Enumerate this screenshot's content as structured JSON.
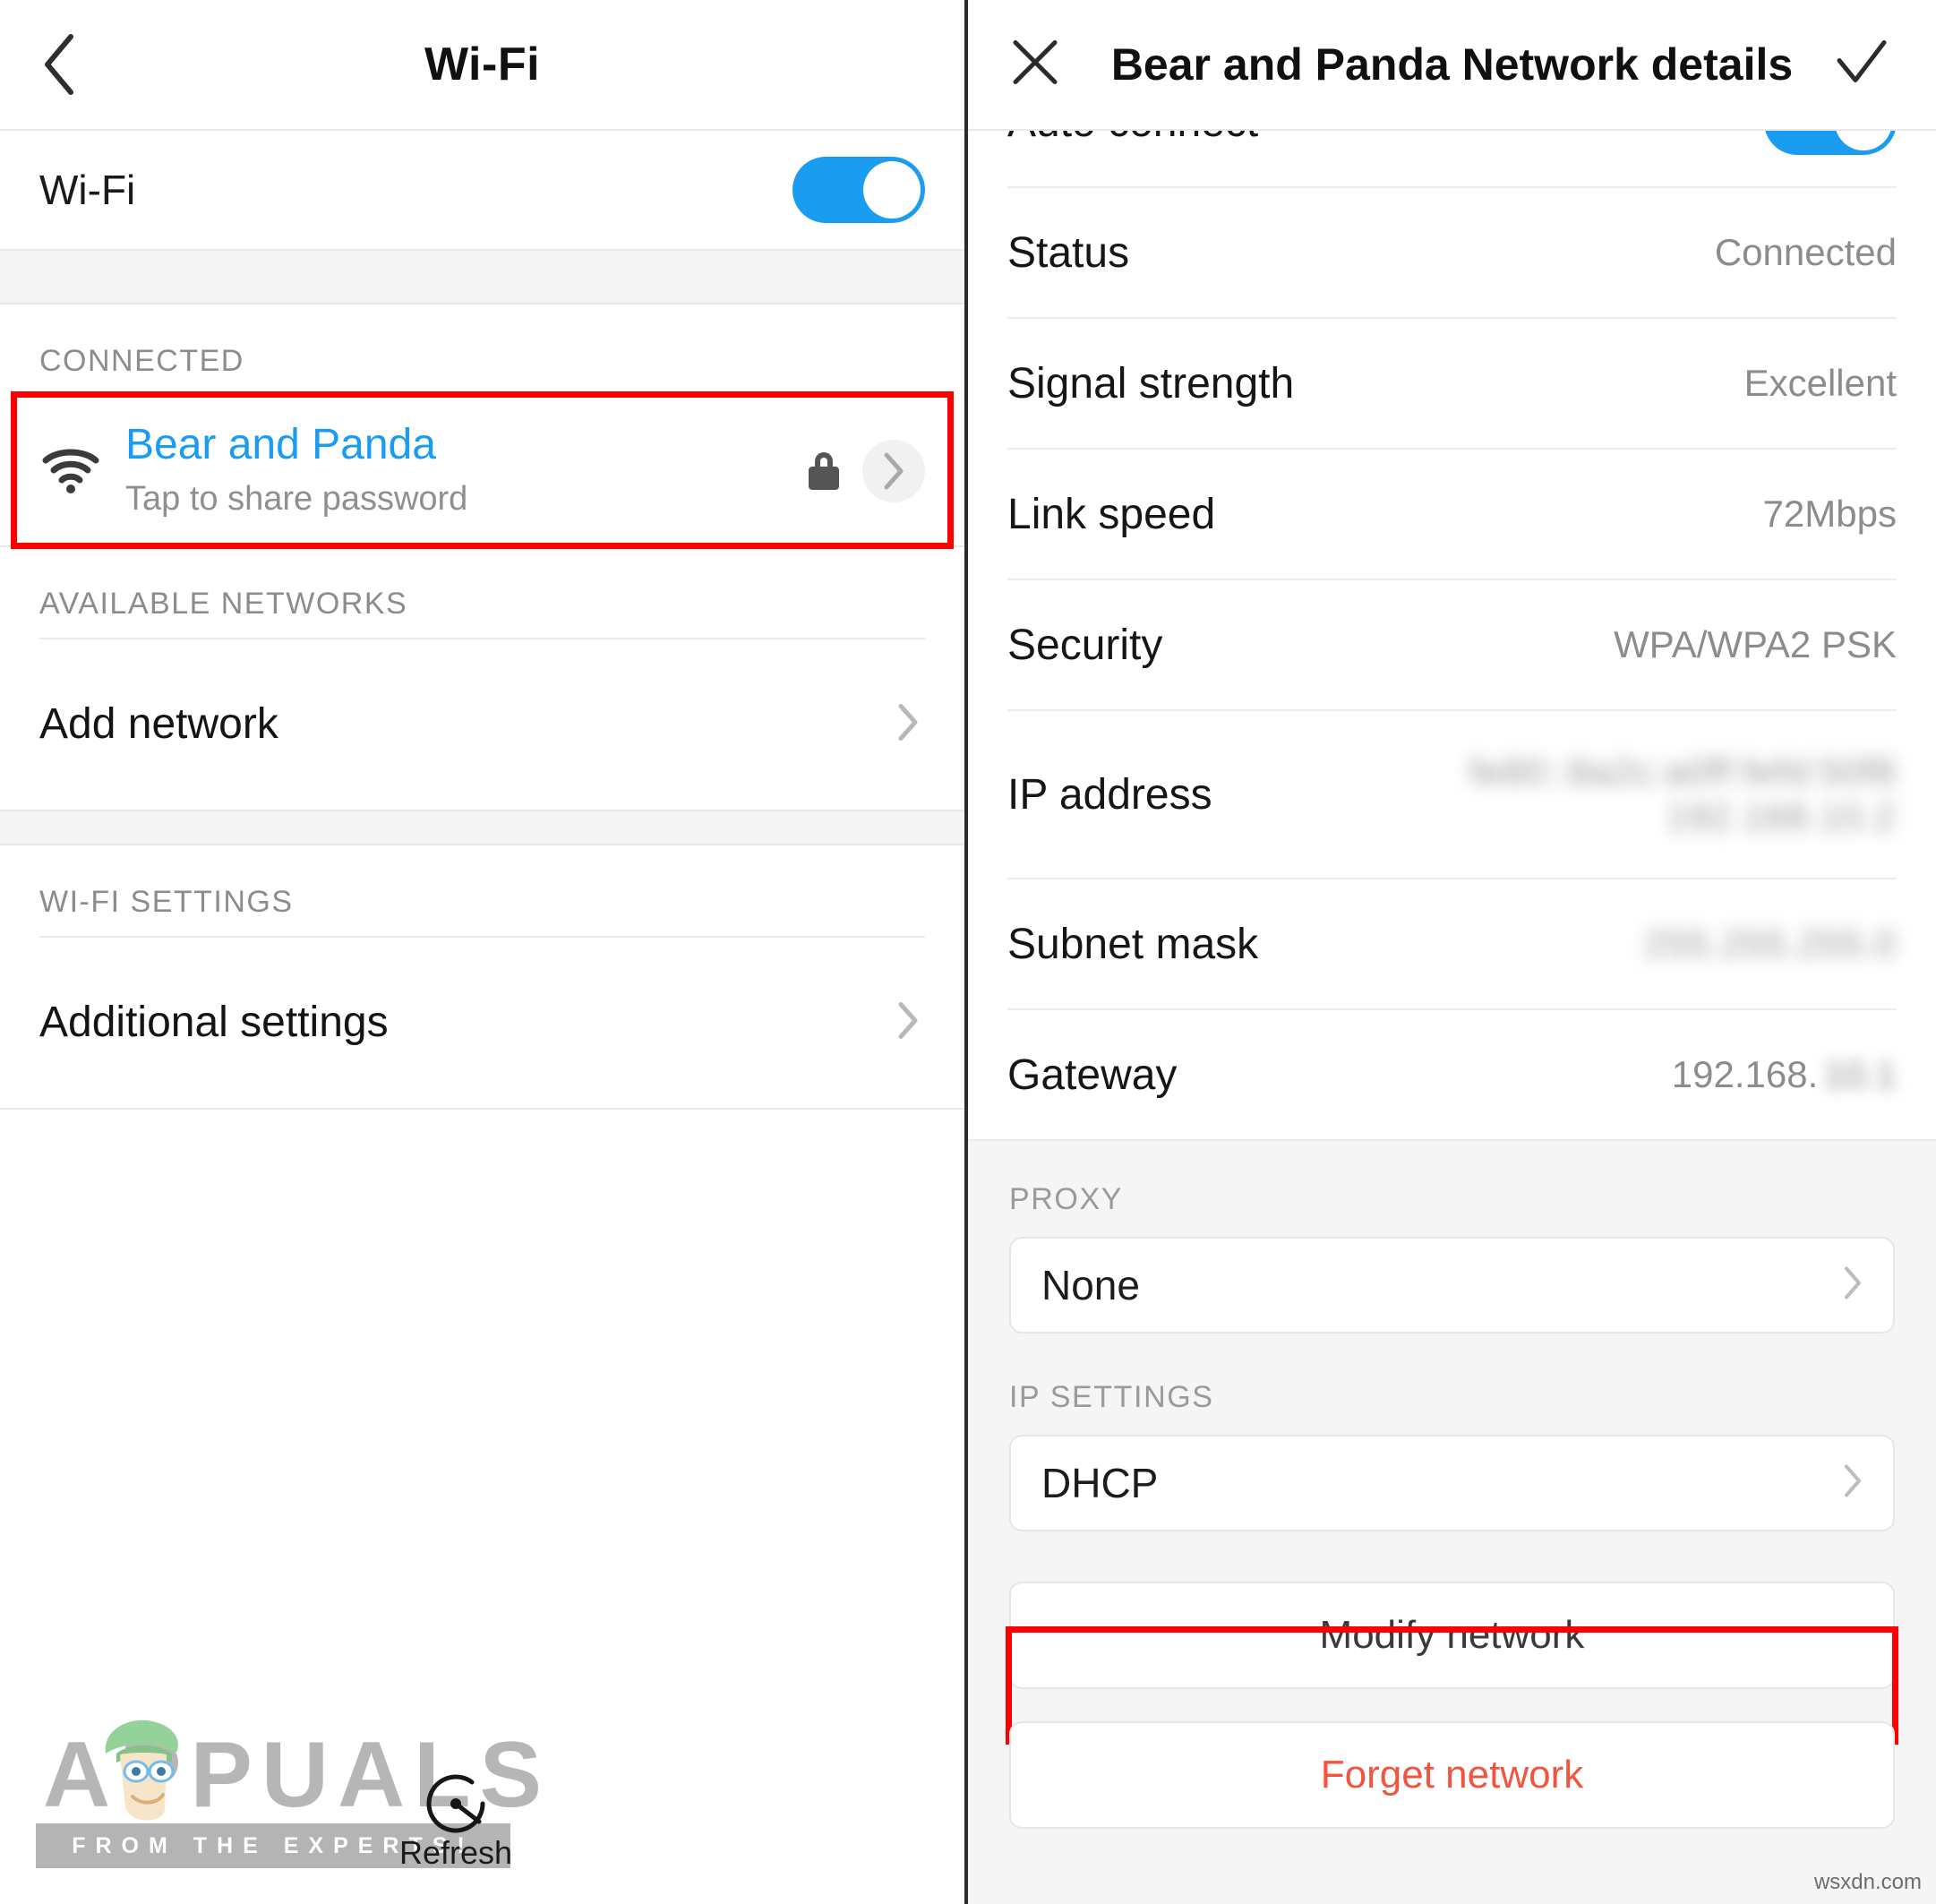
{
  "left": {
    "header": {
      "title": "Wi-Fi",
      "back_icon": "back-chevron-icon"
    },
    "wifi_toggle_row": {
      "label": "Wi-Fi",
      "state": "on"
    },
    "connected_section": {
      "header": "CONNECTED"
    },
    "connected_network": {
      "name": "Bear and Panda",
      "subtitle": "Tap to share password",
      "signal_icon": "wifi-icon",
      "lock_icon": "lock-icon",
      "detail_icon": "chevron-right-icon"
    },
    "available_section": {
      "header": "AVAILABLE NETWORKS"
    },
    "add_network": {
      "label": "Add network",
      "arrow_icon": "chevron-right-icon"
    },
    "settings_section": {
      "header": "WI-FI SETTINGS"
    },
    "additional_settings": {
      "label": "Additional settings",
      "arrow_icon": "chevron-right-icon"
    },
    "watermark": {
      "brand": "APPUALS",
      "tagline": "FROM THE EXPERTS!",
      "overlay_icon": "refresh-icon",
      "overlay_label": "Refresh"
    }
  },
  "right": {
    "header": {
      "title": "Bear and Panda Network details",
      "close_icon": "close-icon",
      "confirm_icon": "check-icon"
    },
    "auto_connect": {
      "label": "Auto connect",
      "state": "on"
    },
    "details": [
      {
        "key": "Status",
        "value": "Connected",
        "blurred": false
      },
      {
        "key": "Signal strength",
        "value": "Excellent",
        "blurred": false
      },
      {
        "key": "Link speed",
        "value": "72Mbps",
        "blurred": false
      },
      {
        "key": "Security",
        "value": "WPA/WPA2 PSK",
        "blurred": false
      }
    ],
    "ip_address": {
      "key": "IP address",
      "value_line1": "fe80::8a2c:a0ff:fefd:50f8",
      "value_line2": "192.168.10.2",
      "blurred": true
    },
    "subnet_mask": {
      "key": "Subnet mask",
      "value": "255.255.255.0",
      "blurred": true
    },
    "gateway": {
      "key": "Gateway",
      "value_visible": "192.168.",
      "value_hidden": "10.1",
      "blurred": true
    },
    "proxy": {
      "label": "PROXY",
      "value": "None",
      "arrow_icon": "chevron-right-icon"
    },
    "ip_settings": {
      "label": "IP SETTINGS",
      "value": "DHCP",
      "arrow_icon": "chevron-right-icon"
    },
    "modify_button": {
      "label": "Modify network"
    },
    "forget_button": {
      "label": "Forget network"
    },
    "watermark": {
      "text": "wsxdn.com"
    }
  },
  "colors": {
    "accent_blue": "#1a9cf0",
    "highlight_red": "#fe0000",
    "forget_red": "#f1543f",
    "muted_gray": "#8c8c8c",
    "panel_gray": "#f5f5f5"
  }
}
